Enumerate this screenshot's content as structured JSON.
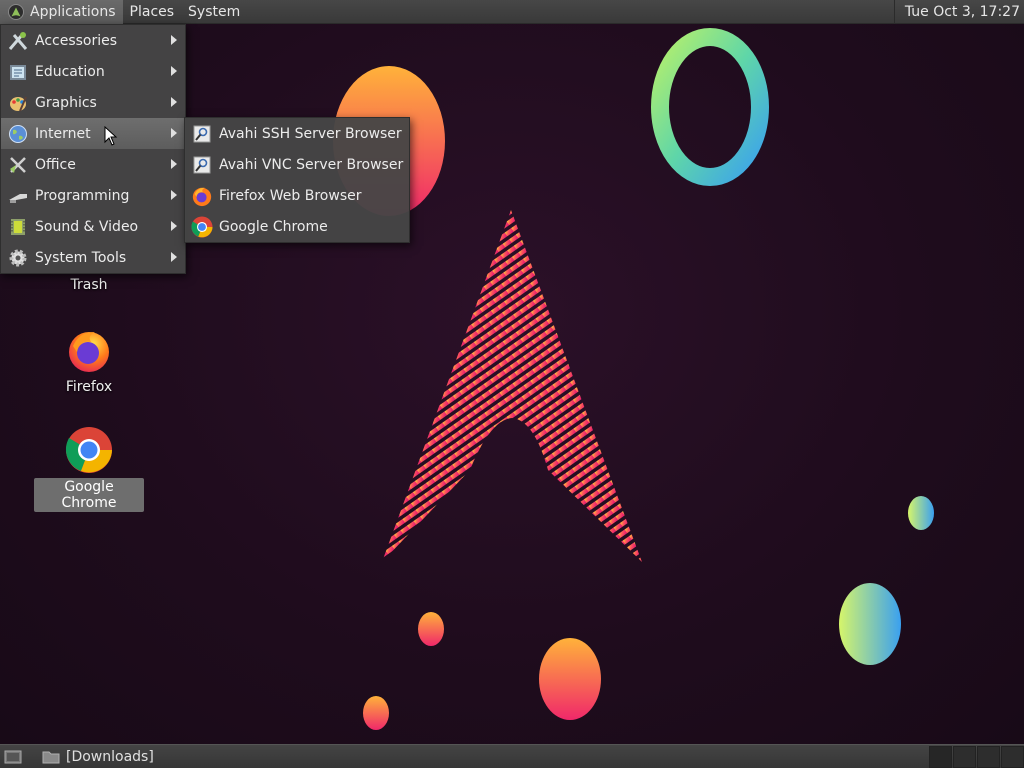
{
  "top_panel": {
    "menus": [
      "Applications",
      "Places",
      "System"
    ],
    "clock": "Tue Oct  3, 17:27"
  },
  "applications_menu": {
    "items": [
      {
        "label": "Accessories",
        "icon": "accessories-icon"
      },
      {
        "label": "Education",
        "icon": "education-icon"
      },
      {
        "label": "Graphics",
        "icon": "graphics-icon"
      },
      {
        "label": "Internet",
        "icon": "globe-icon"
      },
      {
        "label": "Office",
        "icon": "office-icon"
      },
      {
        "label": "Programming",
        "icon": "programming-icon"
      },
      {
        "label": "Sound & Video",
        "icon": "sound-video-icon"
      },
      {
        "label": "System Tools",
        "icon": "gear-icon"
      }
    ],
    "active_item": "Internet"
  },
  "internet_submenu": {
    "items": [
      {
        "label": "Avahi SSH Server Browser",
        "icon": "avahi-icon"
      },
      {
        "label": "Avahi VNC Server Browser",
        "icon": "avahi-icon"
      },
      {
        "label": "Firefox Web Browser",
        "icon": "firefox-icon"
      },
      {
        "label": "Google Chrome",
        "icon": "chrome-icon"
      }
    ]
  },
  "desktop_icons": [
    {
      "label": "Trash",
      "icon": "trash-icon"
    },
    {
      "label": "Firefox",
      "icon": "firefox-icon"
    },
    {
      "label": "Google Chrome",
      "icon": "chrome-icon",
      "selected": true
    }
  ],
  "bottom_panel": {
    "task_label": "[Downloads]"
  },
  "colors": {
    "panel": "#3f3f3f",
    "menu_bg": "#464646",
    "menu_hover": "#666666",
    "wallpaper": "#1f0c1d"
  }
}
